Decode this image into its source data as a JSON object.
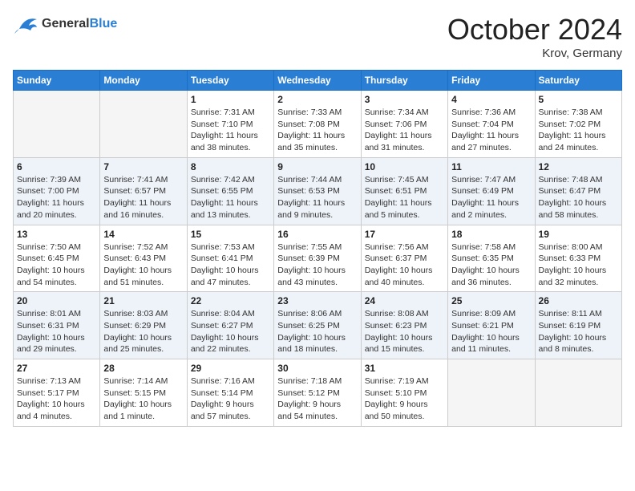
{
  "header": {
    "logo_line1": "General",
    "logo_line2": "Blue",
    "month": "October 2024",
    "location": "Krov, Germany"
  },
  "weekdays": [
    "Sunday",
    "Monday",
    "Tuesday",
    "Wednesday",
    "Thursday",
    "Friday",
    "Saturday"
  ],
  "weeks": [
    [
      {
        "day": "",
        "info": ""
      },
      {
        "day": "",
        "info": ""
      },
      {
        "day": "1",
        "info": "Sunrise: 7:31 AM\nSunset: 7:10 PM\nDaylight: 11 hours\nand 38 minutes."
      },
      {
        "day": "2",
        "info": "Sunrise: 7:33 AM\nSunset: 7:08 PM\nDaylight: 11 hours\nand 35 minutes."
      },
      {
        "day": "3",
        "info": "Sunrise: 7:34 AM\nSunset: 7:06 PM\nDaylight: 11 hours\nand 31 minutes."
      },
      {
        "day": "4",
        "info": "Sunrise: 7:36 AM\nSunset: 7:04 PM\nDaylight: 11 hours\nand 27 minutes."
      },
      {
        "day": "5",
        "info": "Sunrise: 7:38 AM\nSunset: 7:02 PM\nDaylight: 11 hours\nand 24 minutes."
      }
    ],
    [
      {
        "day": "6",
        "info": "Sunrise: 7:39 AM\nSunset: 7:00 PM\nDaylight: 11 hours\nand 20 minutes."
      },
      {
        "day": "7",
        "info": "Sunrise: 7:41 AM\nSunset: 6:57 PM\nDaylight: 11 hours\nand 16 minutes."
      },
      {
        "day": "8",
        "info": "Sunrise: 7:42 AM\nSunset: 6:55 PM\nDaylight: 11 hours\nand 13 minutes."
      },
      {
        "day": "9",
        "info": "Sunrise: 7:44 AM\nSunset: 6:53 PM\nDaylight: 11 hours\nand 9 minutes."
      },
      {
        "day": "10",
        "info": "Sunrise: 7:45 AM\nSunset: 6:51 PM\nDaylight: 11 hours\nand 5 minutes."
      },
      {
        "day": "11",
        "info": "Sunrise: 7:47 AM\nSunset: 6:49 PM\nDaylight: 11 hours\nand 2 minutes."
      },
      {
        "day": "12",
        "info": "Sunrise: 7:48 AM\nSunset: 6:47 PM\nDaylight: 10 hours\nand 58 minutes."
      }
    ],
    [
      {
        "day": "13",
        "info": "Sunrise: 7:50 AM\nSunset: 6:45 PM\nDaylight: 10 hours\nand 54 minutes."
      },
      {
        "day": "14",
        "info": "Sunrise: 7:52 AM\nSunset: 6:43 PM\nDaylight: 10 hours\nand 51 minutes."
      },
      {
        "day": "15",
        "info": "Sunrise: 7:53 AM\nSunset: 6:41 PM\nDaylight: 10 hours\nand 47 minutes."
      },
      {
        "day": "16",
        "info": "Sunrise: 7:55 AM\nSunset: 6:39 PM\nDaylight: 10 hours\nand 43 minutes."
      },
      {
        "day": "17",
        "info": "Sunrise: 7:56 AM\nSunset: 6:37 PM\nDaylight: 10 hours\nand 40 minutes."
      },
      {
        "day": "18",
        "info": "Sunrise: 7:58 AM\nSunset: 6:35 PM\nDaylight: 10 hours\nand 36 minutes."
      },
      {
        "day": "19",
        "info": "Sunrise: 8:00 AM\nSunset: 6:33 PM\nDaylight: 10 hours\nand 32 minutes."
      }
    ],
    [
      {
        "day": "20",
        "info": "Sunrise: 8:01 AM\nSunset: 6:31 PM\nDaylight: 10 hours\nand 29 minutes."
      },
      {
        "day": "21",
        "info": "Sunrise: 8:03 AM\nSunset: 6:29 PM\nDaylight: 10 hours\nand 25 minutes."
      },
      {
        "day": "22",
        "info": "Sunrise: 8:04 AM\nSunset: 6:27 PM\nDaylight: 10 hours\nand 22 minutes."
      },
      {
        "day": "23",
        "info": "Sunrise: 8:06 AM\nSunset: 6:25 PM\nDaylight: 10 hours\nand 18 minutes."
      },
      {
        "day": "24",
        "info": "Sunrise: 8:08 AM\nSunset: 6:23 PM\nDaylight: 10 hours\nand 15 minutes."
      },
      {
        "day": "25",
        "info": "Sunrise: 8:09 AM\nSunset: 6:21 PM\nDaylight: 10 hours\nand 11 minutes."
      },
      {
        "day": "26",
        "info": "Sunrise: 8:11 AM\nSunset: 6:19 PM\nDaylight: 10 hours\nand 8 minutes."
      }
    ],
    [
      {
        "day": "27",
        "info": "Sunrise: 7:13 AM\nSunset: 5:17 PM\nDaylight: 10 hours\nand 4 minutes."
      },
      {
        "day": "28",
        "info": "Sunrise: 7:14 AM\nSunset: 5:15 PM\nDaylight: 10 hours\nand 1 minute."
      },
      {
        "day": "29",
        "info": "Sunrise: 7:16 AM\nSunset: 5:14 PM\nDaylight: 9 hours\nand 57 minutes."
      },
      {
        "day": "30",
        "info": "Sunrise: 7:18 AM\nSunset: 5:12 PM\nDaylight: 9 hours\nand 54 minutes."
      },
      {
        "day": "31",
        "info": "Sunrise: 7:19 AM\nSunset: 5:10 PM\nDaylight: 9 hours\nand 50 minutes."
      },
      {
        "day": "",
        "info": ""
      },
      {
        "day": "",
        "info": ""
      }
    ]
  ]
}
